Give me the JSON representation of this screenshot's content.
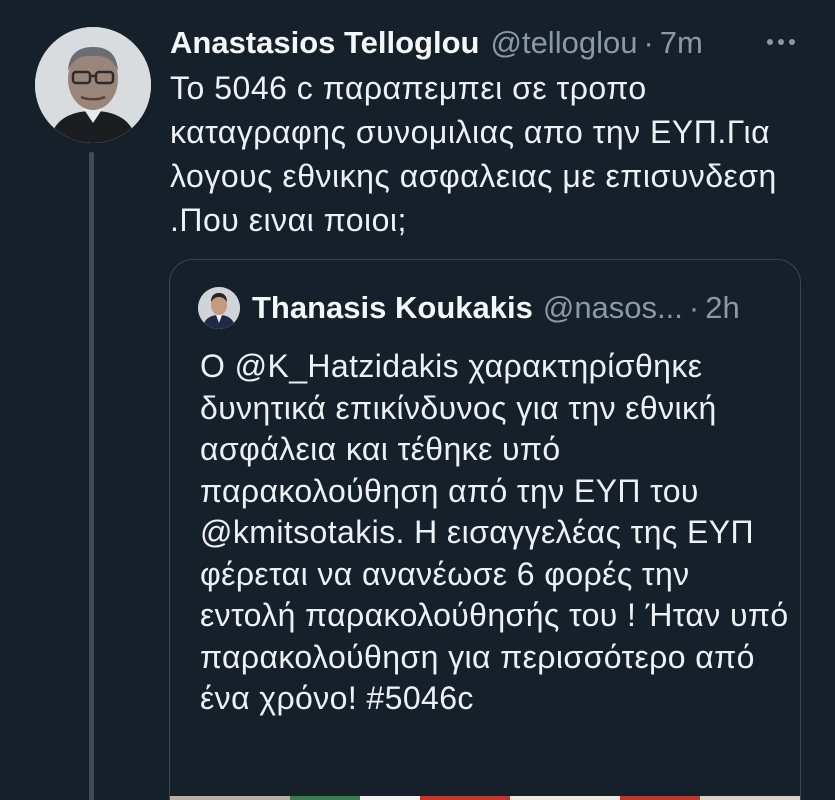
{
  "tweet": {
    "author": {
      "display_name": "Anastasios Telloglou",
      "handle": "@telloglou",
      "avatar_icon": "user-avatar-photo"
    },
    "separator": "·",
    "time": "7m",
    "more_icon": "more-horizontal-icon",
    "text": "Το 5046 c παραπεμπει σε τροπο καταγραφης συνομιλιας απο την ΕΥΠ.Για λογους εθνικης ασφαλειας με επισυνδεση .Που ειναι ποιοι;"
  },
  "quoted_tweet": {
    "author": {
      "display_name": "Thanasis Koukakis",
      "handle": "@nasos...",
      "avatar_icon": "user-avatar-photo"
    },
    "separator": "·",
    "time": "2h",
    "text": "Ο @K_Hatzidakis χαρακτηρίσθηκε δυνητικά επικίνδυνος για την εθνική ασφάλεια και τέθηκε υπό παρακολούθηση από την ΕΥΠ του @kmitsotakis. Η εισαγγελέας της ΕΥΠ φέρεται να ανανέωσε 6 φορές την εντολή παρακολούθησής του ! Ήταν υπό παρακολούθηση για περισσότερο από ένα χρόνο! #5046c"
  },
  "colors": {
    "background": "#16202b",
    "text_primary": "#eef1f3",
    "text_secondary": "#8b98a5",
    "border": "#3a4550",
    "thread_line": "#3e4a55"
  }
}
